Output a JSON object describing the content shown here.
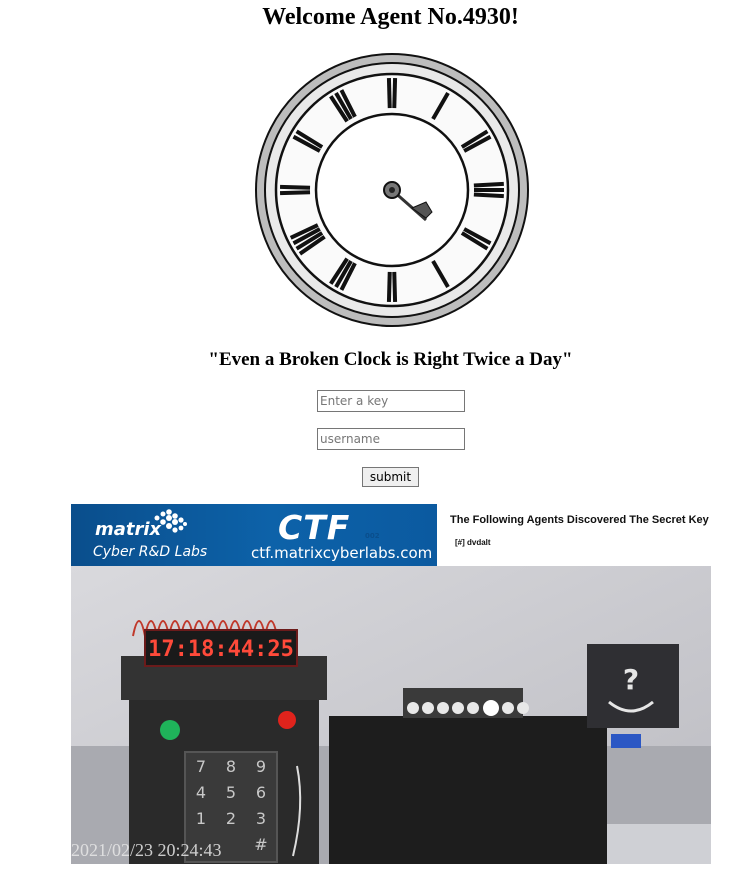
{
  "header": {
    "title": "Welcome Agent No.4930!"
  },
  "quote": "\"Even a Broken Clock is Right Twice a Day\"",
  "form": {
    "key_placeholder": "Enter a key",
    "username_placeholder": "username",
    "submit_label": "submit"
  },
  "panel": {
    "banner": {
      "brand": "matrix",
      "labs": "Cyber R&D Labs",
      "ctf": "CTF",
      "ctf_sub": "002",
      "url": "ctf.matrixcyberlabs.com"
    },
    "agents_heading": "The Following Agents Discovered The Secret Key",
    "agents": [
      "[#] dvdalt"
    ],
    "camera": {
      "display_digits": "17:18:44:25",
      "question_mark": "?",
      "keypad": [
        "7",
        "8",
        "9",
        "4",
        "5",
        "6",
        "1",
        "2",
        "3",
        "#"
      ],
      "timestamp": "2021/02/23 20:24:43"
    }
  },
  "colors": {
    "led_green": "#1fb35a",
    "led_red": "#e0231c",
    "banner_blue": "#0d62a9",
    "segment_red": "#ff4a3a"
  }
}
